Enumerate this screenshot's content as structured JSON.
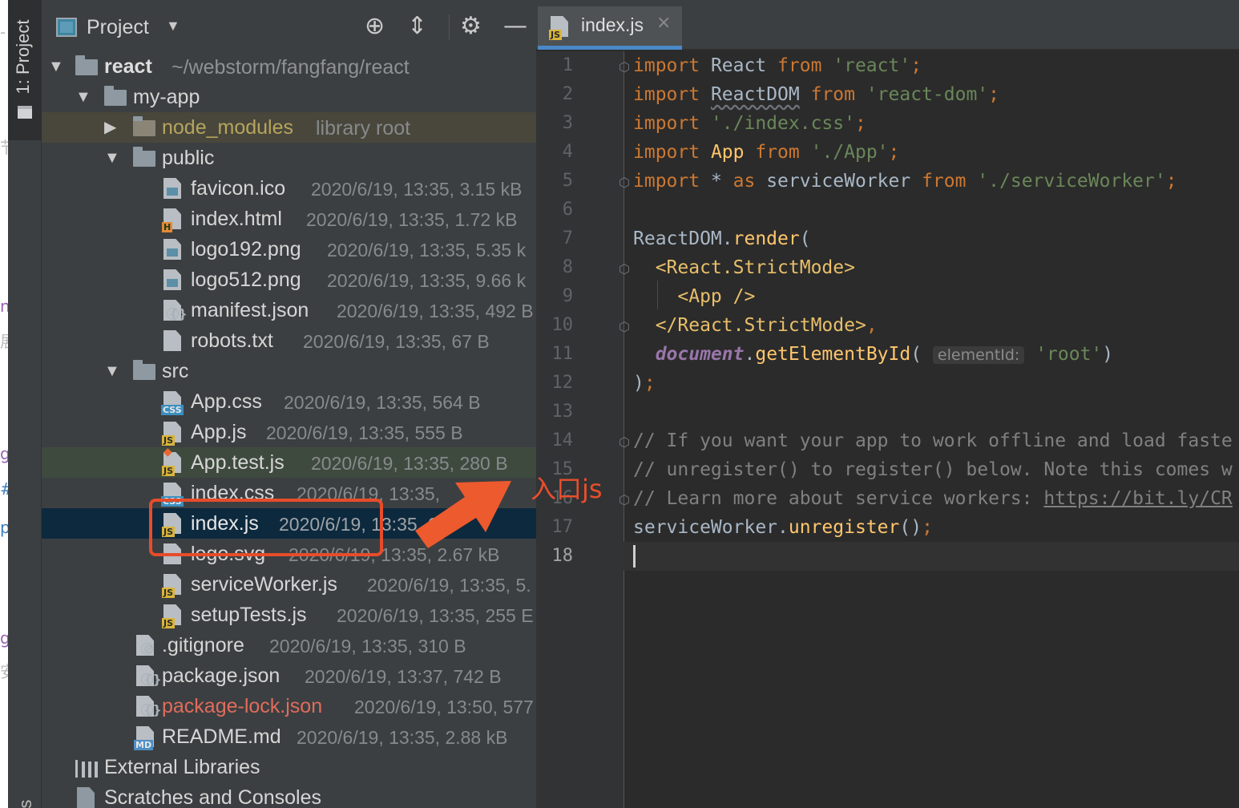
{
  "stripe": {
    "project_label": "1: Project",
    "favorites_label": "tes"
  },
  "left_strip_glyphs": [
    "‐",
    "节",
    "n",
    "展",
    "g",
    "#",
    "p",
    "g",
    "安"
  ],
  "project_panel": {
    "title": "Project",
    "dropdown": "▼",
    "icons": [
      "crosshair-icon",
      "collapse-icon",
      "gear-icon",
      "minimize-icon"
    ]
  },
  "tree": {
    "root": {
      "name": "react",
      "path": "~/webstorm/fangfang/react"
    },
    "my_app": {
      "name": "my-app"
    },
    "node_modules": {
      "name": "node_modules",
      "note": "library root"
    },
    "public": {
      "name": "public"
    },
    "public_files": [
      {
        "name": "favicon.ico",
        "meta": "2020/6/19, 13:35, 3.15 kB",
        "type": "img"
      },
      {
        "name": "index.html",
        "meta": "2020/6/19, 13:35, 1.72 kB",
        "type": "html"
      },
      {
        "name": "logo192.png",
        "meta": "2020/6/19, 13:35, 5.35 k",
        "type": "img"
      },
      {
        "name": "logo512.png",
        "meta": "2020/6/19, 13:35, 9.66 k",
        "type": "img"
      },
      {
        "name": "manifest.json",
        "meta": "2020/6/19, 13:35, 492 B",
        "type": "cfg"
      },
      {
        "name": "robots.txt",
        "meta": "2020/6/19, 13:35, 67 B",
        "type": "txt"
      }
    ],
    "src": {
      "name": "src"
    },
    "src_files": [
      {
        "name": "App.css",
        "meta": "2020/6/19, 13:35, 564 B",
        "type": "css"
      },
      {
        "name": "App.js",
        "meta": "2020/6/19, 13:35, 555 B",
        "type": "js"
      },
      {
        "name": "App.test.js",
        "meta": "2020/6/19, 13:35, 280 B",
        "type": "test"
      },
      {
        "name": "index.css",
        "meta": "2020/6/19, 13:35, ",
        "type": "css"
      },
      {
        "name": "index.js",
        "meta": "2020/6/19, 13:35, 603",
        "type": "js"
      },
      {
        "name": "logo.svg",
        "meta": "2020/6/19, 13:35, 2.67 kB",
        "type": "img"
      },
      {
        "name": "serviceWorker.js",
        "meta": "2020/6/19, 13:35, 5.",
        "type": "js"
      },
      {
        "name": "setupTests.js",
        "meta": "2020/6/19, 13:35, 255 E",
        "type": "js"
      }
    ],
    "app_files": [
      {
        "name": ".gitignore",
        "meta": "2020/6/19, 13:35, 310 B",
        "type": "ignore"
      },
      {
        "name": "package.json",
        "meta": "2020/6/19, 13:37, 742 B",
        "type": "cfg"
      },
      {
        "name": "package-lock.json",
        "meta": "2020/6/19, 13:50, 577",
        "type": "cfg"
      },
      {
        "name": "README.md",
        "meta": "2020/6/19, 13:35, 2.88 kB",
        "type": "md"
      }
    ],
    "external_libraries": "External Libraries",
    "scratches": "Scratches and Consoles"
  },
  "editor": {
    "tab_label": "index.js",
    "tab_close": "×",
    "line_numbers": [
      "1",
      "2",
      "3",
      "4",
      "5",
      "6",
      "7",
      "8",
      "9",
      "10",
      "11",
      "12",
      "13",
      "14",
      "15",
      "16",
      "17",
      "18"
    ],
    "current_line": "18",
    "code": {
      "l1": {
        "k1": "import",
        "t1": " React ",
        "k2": "from",
        "s1": " 'react'",
        "p": ";"
      },
      "l2": {
        "k1": "import",
        "t1": " ",
        "t2": "ReactDOM",
        "t3": " ",
        "k2": "from",
        "s1": " 'react-dom'",
        "p": ";"
      },
      "l3": {
        "k1": "import",
        "s1": " './index.css'",
        "p": ";"
      },
      "l4": {
        "k1": "import",
        "t1": " ",
        "f1": "App",
        "t2": " ",
        "k2": "from",
        "s1": " './App'",
        "p": ";"
      },
      "l5": {
        "k1": "import",
        "t1": " * ",
        "k2": "as",
        "t2": " serviceWorker ",
        "k3": "from",
        "s1": " './serviceWorker'",
        "p": ";"
      },
      "l7": {
        "t1": "ReactDOM.",
        "f1": "render",
        "t2": "("
      },
      "l8": {
        "t1": "  ",
        "g1": "<React.StrictMode>"
      },
      "l9": {
        "t1": "    ",
        "g1": "<App />"
      },
      "l10": {
        "t1": "  ",
        "g1": "</React.StrictMode>",
        "p": ","
      },
      "l11": {
        "t1": "  ",
        "d1": "document",
        "t2": ".",
        "f1": "getElementById",
        "t3": "( ",
        "h1": "elementId:",
        "s1": " 'root'",
        "t4": ")"
      },
      "l12": {
        "t1": ")",
        "p": ";"
      },
      "l14": {
        "c1": "// If you want your app to work offline and load faste"
      },
      "l15": {
        "c1": "// unregister() to register() below. Note this comes w"
      },
      "l16": {
        "c1": "// Learn more about service workers: ",
        "u1": "https://bit.ly/CR"
      },
      "l17": {
        "t1": "serviceWorker.",
        "f1": "unregister",
        "t2": "()",
        "p": ";"
      }
    }
  },
  "annotation": {
    "text": "入口js",
    "color": "#e84e2c"
  }
}
